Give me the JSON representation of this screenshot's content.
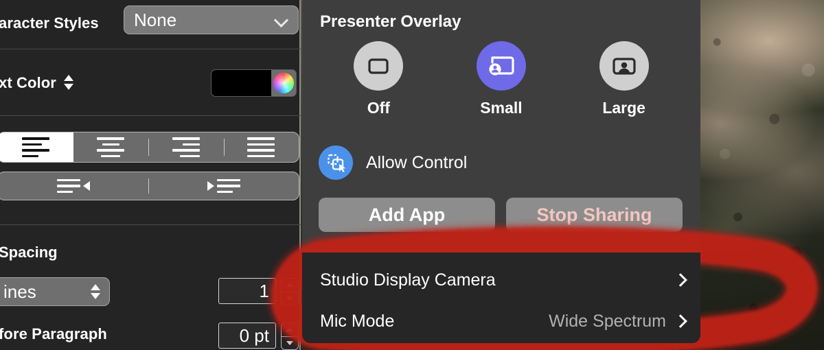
{
  "left_panel": {
    "character_styles": {
      "label": "aracter Styles",
      "value": "None",
      "chevron_icon": "chevron-down-icon"
    },
    "text_color": {
      "label": "xt Color",
      "stepper_icon": "up-down-arrows-icon",
      "swatch_color": "#000000",
      "wheel_icon": "color-wheel-icon"
    },
    "alignment": {
      "options": [
        {
          "name": "align-left",
          "icon": "align-left-icon",
          "selected": true
        },
        {
          "name": "align-center",
          "icon": "align-center-icon",
          "selected": false
        },
        {
          "name": "align-right",
          "icon": "align-right-icon",
          "selected": false
        },
        {
          "name": "align-justify",
          "icon": "align-justify-icon",
          "selected": false
        }
      ]
    },
    "indent": {
      "options": [
        {
          "name": "decrease-indent",
          "icon": "outdent-icon"
        },
        {
          "name": "increase-indent",
          "icon": "indent-icon"
        }
      ]
    },
    "spacing": {
      "title": "Spacing",
      "line_spacing": {
        "mode": "ines",
        "value": "1",
        "mode_stepper_icon": "up-down-arrows-icon",
        "stepper_icon": "stepper-icon"
      },
      "before_paragraph": {
        "label": "fore Paragraph",
        "value": "0 pt",
        "stepper_icon": "stepper-icon"
      }
    }
  },
  "popover": {
    "title": "Presenter Overlay",
    "overlay_options": [
      {
        "label": "Off",
        "icon": "screen-outline-icon",
        "selected": false
      },
      {
        "label": "Small",
        "icon": "screen-with-person-icon",
        "selected": true
      },
      {
        "label": "Large",
        "icon": "person-in-frame-icon",
        "selected": false
      }
    ],
    "allow_control": {
      "label": "Allow Control",
      "icon": "remote-control-cursor-icon",
      "enabled": true
    },
    "buttons": [
      {
        "label": "Add App",
        "style": "normal"
      },
      {
        "label": "Stop Sharing",
        "style": "destructive"
      }
    ],
    "menu_rows": [
      {
        "label": "Studio Display Camera",
        "value": "",
        "chevron_icon": "chevron-right-icon"
      },
      {
        "label": "Mic Mode",
        "value": "Wide Spectrum",
        "chevron_icon": "chevron-right-icon"
      }
    ]
  },
  "annotation": {
    "type": "hand-drawn-oval-highlight",
    "color": "#c3241c",
    "target": "Studio Display Camera and Mic Mode rows"
  },
  "colors": {
    "popover_bg": "#3e3e3e",
    "popover_bottom_bg": "#262626",
    "left_panel_bg": "#242424",
    "accent": "#6e6ae8",
    "allow_control_blue": "#4b91ea",
    "button_gray": "#8d8d8d",
    "destructive_text": "#f3c7c0",
    "secondary_text": "#b1b1b1",
    "annotation_red": "#c3241c"
  }
}
